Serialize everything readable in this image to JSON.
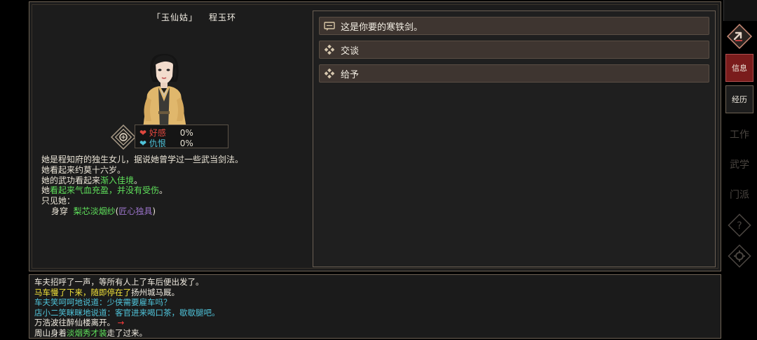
{
  "npc": {
    "nickname": "「玉仙姑」",
    "name": "程玉环",
    "affection_label": "好感",
    "affection_value": "0%",
    "hatred_label": "仇恨",
    "hatred_value": "0%"
  },
  "description": {
    "line1": "她是程知府的独生女儿，据说她曾学过一些武当剑法。",
    "line2": "她看起来约莫十六岁。",
    "line3_prefix": "她的武功看起来",
    "line3_highlight": "渐入佳境",
    "line3_suffix": "。",
    "line4_prefix": "她",
    "line4_highlight": "看起来气血充盈，并没有受伤",
    "line4_suffix": "。",
    "line5": "只见她：",
    "wear_label": "身穿",
    "wear_item": "梨芯淡烟纱",
    "wear_quality_open": "(",
    "wear_quality": "匠心独具",
    "wear_quality_close": ")"
  },
  "dialog_options": [
    {
      "label": "这是你要的寒铁剑。",
      "icon": "chat-icon"
    },
    {
      "label": "交谈",
      "icon": "diamond-icon"
    },
    {
      "label": "给予",
      "icon": "diamond-icon"
    }
  ],
  "log": {
    "l1": "车夫招呼了一声，等所有人上了车后便出发了。",
    "l2_a": "马车慢了下来，随即停在了",
    "l2_b": "扬州城马厩。",
    "l3": "车夫笑呵呵地说道：少侠需要雇车吗？",
    "l4": "店小二笑眯眯地说道：客官进来喝口茶，歇歇腿吧。",
    "l5": "万浩波往醉仙楼离开。",
    "l5_arrow": "→",
    "l6_a": "周山身着",
    "l6_b": "淡烟秀才装",
    "l6_c": "走了过来。"
  },
  "sidebar": {
    "info_label": "信息",
    "history_label": "经历",
    "work_label": "工作",
    "martial_label": "武学",
    "sect_label": "门派"
  },
  "colors": {
    "green": "#5fe05b",
    "purple": "#9a73c9",
    "yellow": "#f3e33a",
    "cyan": "#4fc3d9",
    "red_tab": "#8a1a1a"
  }
}
